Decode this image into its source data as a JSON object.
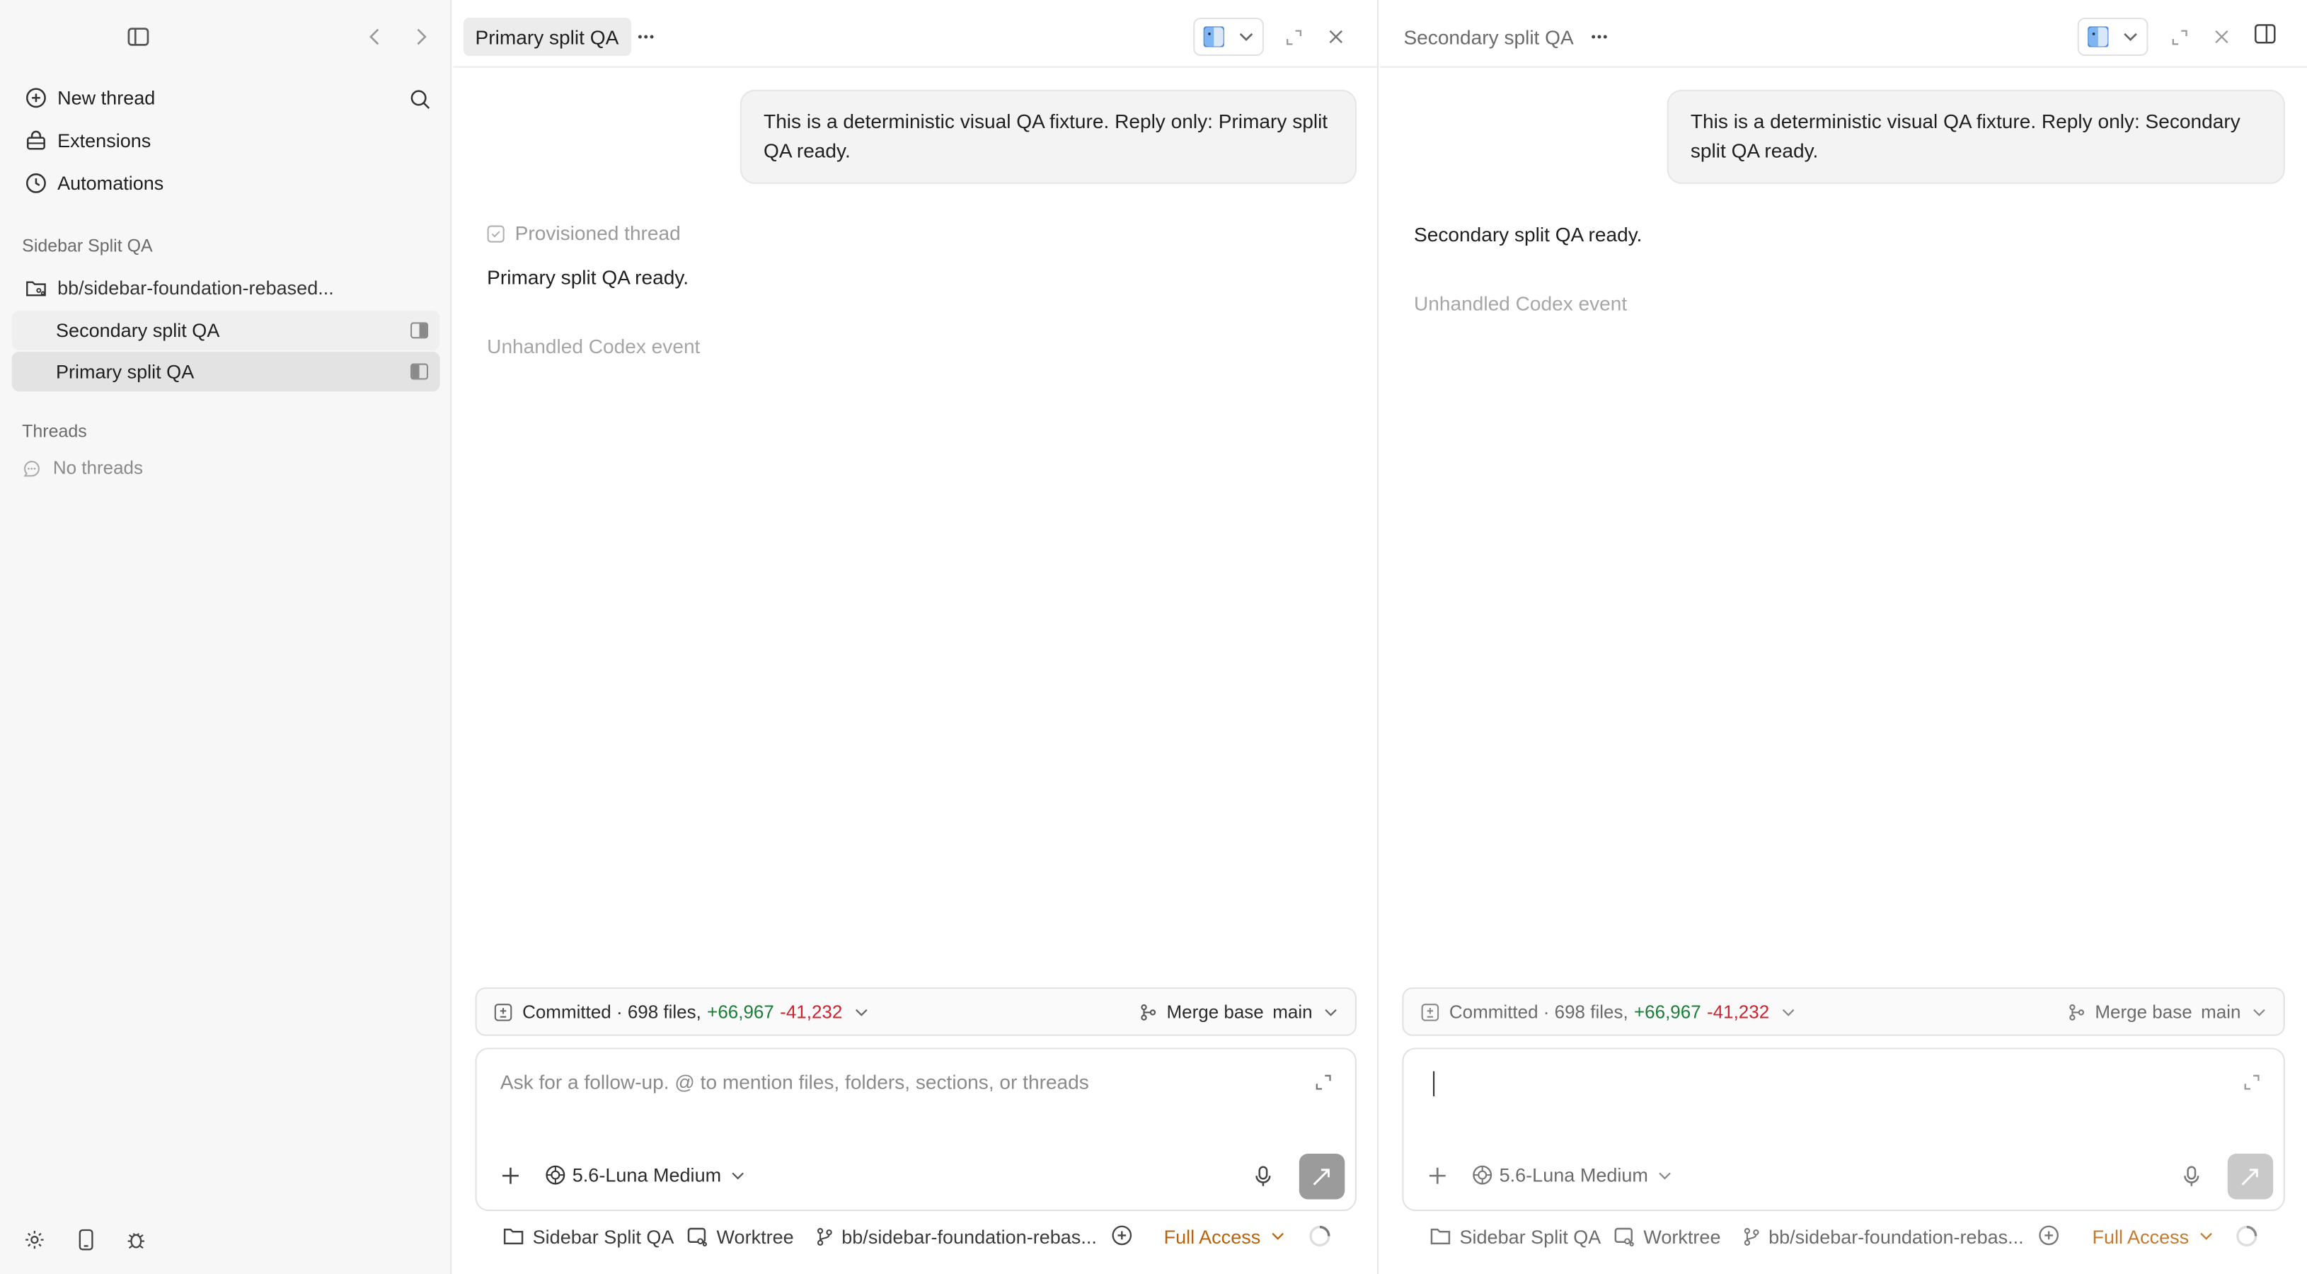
{
  "sidebar": {
    "nav": [
      {
        "label": "New thread",
        "icon": "plus-circle-icon"
      },
      {
        "label": "Extensions",
        "icon": "extensions-icon"
      },
      {
        "label": "Automations",
        "icon": "clock-icon"
      }
    ],
    "project_section": "Sidebar Split QA",
    "branch_item": "bb/sidebar-foundation-rebased...",
    "threads_in_project": [
      {
        "label": "Secondary split QA",
        "split": "right"
      },
      {
        "label": "Primary split QA",
        "split": "left"
      }
    ],
    "threads_section": "Threads",
    "no_threads": "No threads"
  },
  "panes": [
    {
      "title": "Primary split QA",
      "title_active": true,
      "user_message": "This is a deterministic visual QA fixture. Reply only: Primary split QA ready.",
      "provisioned_label": "Provisioned thread",
      "reply": "Primary split QA ready.",
      "event_note": "Unhandled Codex event",
      "diff": {
        "committed": "Committed · 698 files,",
        "added": "+66,967",
        "removed": "-41,232",
        "merge_label": "Merge base",
        "merge_branch": "main"
      },
      "composer": {
        "placeholder": "Ask for a follow-up. @ to mention files, folders, sections, or threads",
        "model": "5.6-Luna Medium"
      },
      "status": {
        "project": "Sidebar Split QA",
        "worktree": "Worktree",
        "branch": "bb/sidebar-foundation-rebas...",
        "access": "Full Access"
      }
    },
    {
      "title": "Secondary split QA",
      "title_active": false,
      "user_message": "This is a deterministic visual QA fixture. Reply only: Secondary split QA ready.",
      "reply": "Secondary split QA ready.",
      "event_note": "Unhandled Codex event",
      "diff": {
        "committed": "Committed · 698 files,",
        "added": "+66,967",
        "removed": "-41,232",
        "merge_label": "Merge base",
        "merge_branch": "main"
      },
      "composer": {
        "placeholder": "",
        "model": "5.6-Luna Medium"
      },
      "status": {
        "project": "Sidebar Split QA",
        "worktree": "Worktree",
        "branch": "bb/sidebar-foundation-rebas...",
        "access": "Full Access"
      }
    }
  ],
  "colors": {
    "added": "#1a7f37",
    "removed": "#cf222e",
    "access": "#b9620b",
    "selected_row": "#e3e3e3"
  }
}
